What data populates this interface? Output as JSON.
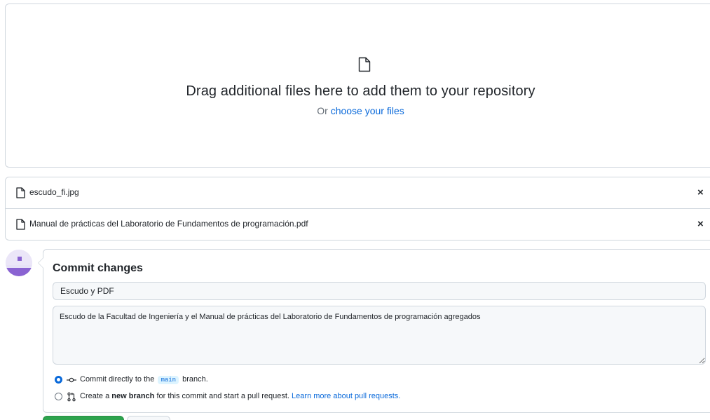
{
  "dropzone": {
    "icon": "file-icon",
    "title": "Drag additional files here to add them to your repository",
    "or_text": "Or",
    "choose_link": "choose your files"
  },
  "files": [
    {
      "icon": "file-icon",
      "name": "escudo_fi.jpg",
      "remove_icon": "close-icon",
      "remove_label": "×"
    },
    {
      "icon": "file-icon",
      "name": "Manual de prácticas del Laboratorio de Fundamentos de programación.pdf",
      "remove_icon": "close-icon",
      "remove_label": "×"
    }
  ],
  "commit": {
    "title": "Commit changes",
    "summary_value": "Escudo y PDF",
    "description_value": "Escudo de la Facultad de Ingeniería y el Manual de prácticas del Laboratorio de Fundamentos de programación agregados",
    "option_direct": {
      "selected": true,
      "icon": "git-commit-icon",
      "prefix": "Commit directly to the",
      "branch": "main",
      "suffix": "branch."
    },
    "option_new_branch": {
      "selected": false,
      "icon": "git-pull-request-icon",
      "prefix": "Create a",
      "bold": "new branch",
      "middle": "for this commit and start a pull request.",
      "link": "Learn more about pull requests."
    }
  },
  "colors": {
    "accent": "#0969da",
    "border": "#d0d7de",
    "primary_button": "#2da44e",
    "avatar": "#8a63d2"
  }
}
